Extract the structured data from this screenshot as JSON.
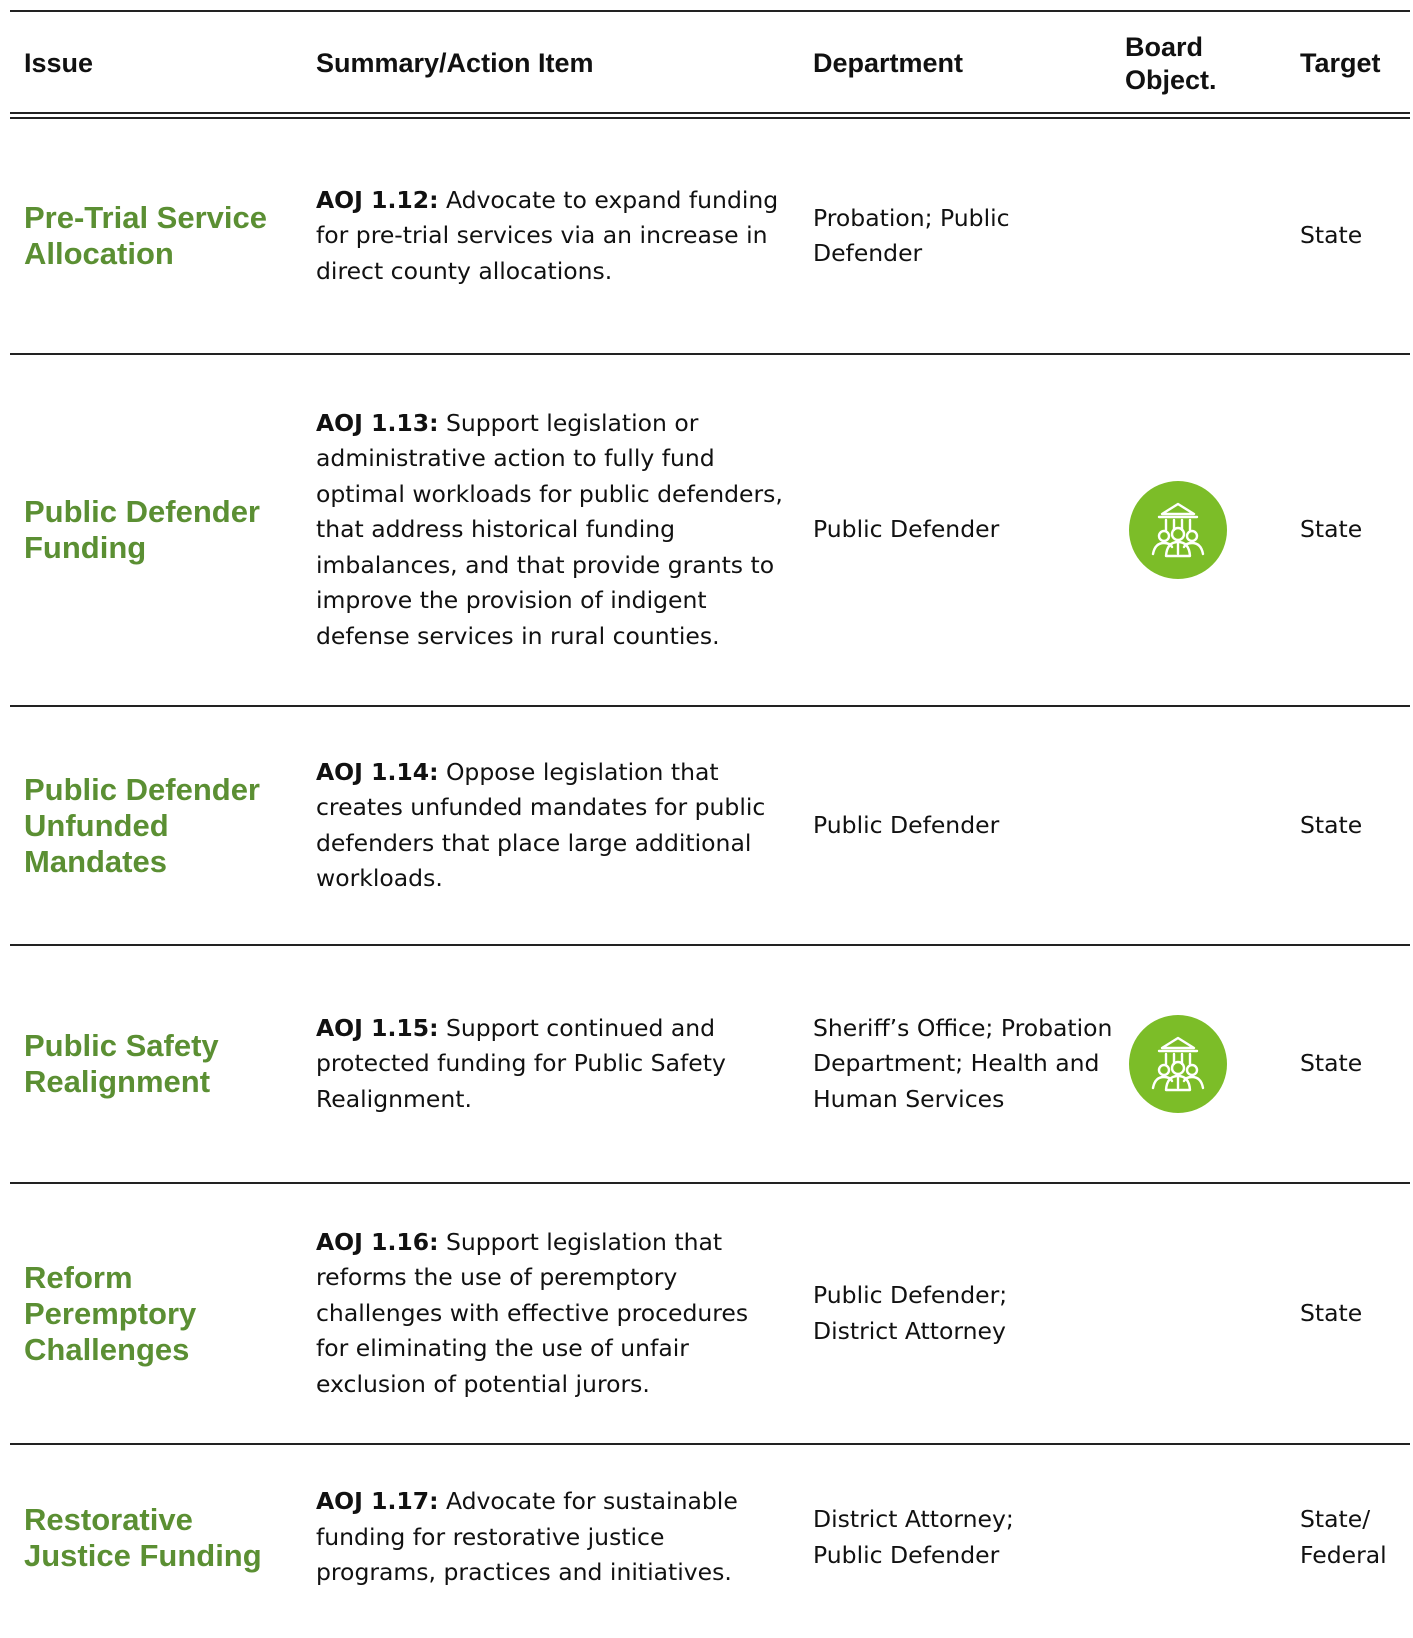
{
  "header": {
    "issue": "Issue",
    "summary": "Summary/Action Item",
    "department": "Department",
    "board_line1": "Board",
    "board_line2": "Object.",
    "target": "Target"
  },
  "accent_color": "#5b8f33",
  "board_icon": {
    "name": "courthouse-people-icon",
    "color": "#7cbd28"
  },
  "rows": [
    {
      "issue": "Pre-Trial Service Allocation",
      "code": "AOJ 1.12:",
      "summary": " Advocate to expand funding for pre-trial services via an increase in direct county allocations.",
      "department": "Probation; Public Defender",
      "board_objective": false,
      "target": "State"
    },
    {
      "issue": "Public Defender Funding",
      "code": "AOJ 1.13:",
      "summary": " Support legislation or administrative action to fully fund optimal workloads for public defenders, that address historical funding imbalances, and that provide grants to improve the provision of indigent defense services in rural counties.",
      "department": "Public Defender",
      "board_objective": true,
      "target": "State"
    },
    {
      "issue": "Public Defender Unfunded Mandates",
      "code": "AOJ 1.14:",
      "summary": " Oppose legislation that creates unfunded mandates for public defenders that place large additional workloads.",
      "department": "Public Defender",
      "board_objective": false,
      "target": "State"
    },
    {
      "issue": "Public Safety Realignment",
      "code": "AOJ 1.15:",
      "summary": " Support continued and protected funding for  Public Safety Realignment.",
      "department": "Sheriff’s Office; Probation Department; Health and Human Services",
      "board_objective": true,
      "target": "State"
    },
    {
      "issue": "Reform Peremptory Challenges",
      "code": "AOJ 1.16:",
      "summary": " Support legislation that reforms the use of peremptory challenges with effective procedures for eliminating the use of unfair exclusion of potential jurors.",
      "department": "Public Defender; District Attorney",
      "board_objective": false,
      "target": "State"
    },
    {
      "issue": "Restorative Justice Funding",
      "code": "AOJ 1.17:",
      "summary": " Advocate for sustainable funding for restorative justice programs, practices and initiatives.",
      "department": "District Attorney; Public Defender",
      "board_objective": false,
      "target": "State/\nFederal"
    }
  ]
}
